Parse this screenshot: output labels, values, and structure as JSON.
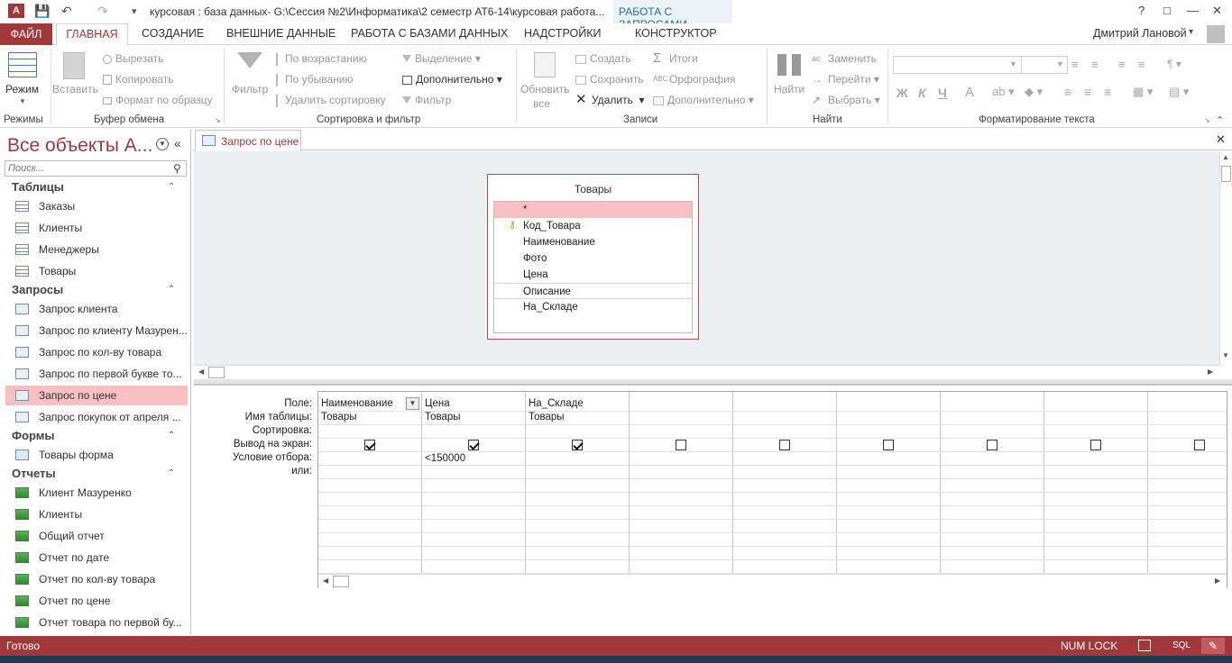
{
  "window": {
    "title": "курсовая : база данных- G:\\Сессия №2\\Информатика\\2 семестр АТ6-14\\курсовая работа...",
    "context_tab": "РАБОТА С ЗАПРОСАМИ",
    "help": "?",
    "user": "Дмитрий Лановой"
  },
  "tabs": {
    "file": "ФАЙЛ",
    "home": "ГЛАВНАЯ",
    "create": "СОЗДАНИЕ",
    "external": "ВНЕШНИЕ ДАННЫЕ",
    "database": "РАБОТА С БАЗАМИ ДАННЫХ",
    "addins": "НАДСТРОЙКИ",
    "designer": "КОНСТРУКТОР"
  },
  "ribbon": {
    "views": {
      "mode": "Режим",
      "group": "Режимы"
    },
    "clipboard": {
      "paste": "Вставить",
      "cut": "Вырезать",
      "copy": "Копировать",
      "format": "Формат по образцу",
      "group": "Буфер обмена"
    },
    "sort": {
      "filter": "Фильтр",
      "asc": "По возрастанию",
      "desc": "По убыванию",
      "remove": "Удалить сортировку",
      "selection": "Выделение",
      "advanced": "Дополнительно",
      "toggle": "Фильтр",
      "group": "Сортировка и фильтр"
    },
    "records": {
      "refresh1": "Обновить",
      "refresh2": "все",
      "new": "Создать",
      "save": "Сохранить",
      "delete": "Удалить",
      "totals": "Итоги",
      "spelling": "Орфография",
      "more": "Дополнительно",
      "group": "Записи"
    },
    "find": {
      "find": "Найти",
      "replace": "Заменить",
      "goto": "Перейти",
      "select": "Выбрать",
      "group": "Найти"
    },
    "text": {
      "group": "Форматирование текста",
      "bold": "Ж",
      "italic": "К",
      "underline": "Ч",
      "fontcolor": "A"
    }
  },
  "nav": {
    "title": "Все объекты A...",
    "search_placeholder": "Поиск...",
    "sections": [
      {
        "label": "Таблицы",
        "items": [
          "Заказы",
          "Клиенты",
          "Менеджеры",
          "Товары"
        ]
      },
      {
        "label": "Запросы",
        "items": [
          "Запрос клиента",
          "Запрос по клиенту Мазурен...",
          "Запрос по кол-ву товара",
          "Запрос по первой букве то...",
          "Запрос по цене",
          "Запрос покупок от апреля ..."
        ]
      },
      {
        "label": "Формы",
        "items": [
          "Товары форма"
        ]
      },
      {
        "label": "Отчеты",
        "items": [
          "Клиент Мазуренко",
          "Клиенты",
          "Общий отчет",
          "Отчет по дате",
          "Отчет по кол-ву товара",
          "Отчет по цене",
          "Отчет товара по первой бу..."
        ]
      }
    ]
  },
  "document": {
    "tab": "Запрос по цене",
    "table": {
      "name": "Товары",
      "fields": [
        "*",
        "Код_Товара",
        "Наименование",
        "Фото",
        "Цена",
        "Описание",
        "На_Складе"
      ]
    },
    "grid": {
      "row_labels": [
        "Поле:",
        "Имя таблицы:",
        "Сортировка:",
        "Вывод на экран:",
        "Условие отбора:",
        "или:"
      ],
      "columns": [
        {
          "field": "Наименование",
          "table": "Товары",
          "show": true,
          "criteria": ""
        },
        {
          "field": "Цена",
          "table": "Товары",
          "show": true,
          "criteria": "<150000"
        },
        {
          "field": "На_Складе",
          "table": "Товары",
          "show": true,
          "criteria": ""
        },
        {
          "field": "",
          "table": "",
          "show": false,
          "criteria": ""
        },
        {
          "field": "",
          "table": "",
          "show": false,
          "criteria": ""
        },
        {
          "field": "",
          "table": "",
          "show": false,
          "criteria": ""
        },
        {
          "field": "",
          "table": "",
          "show": false,
          "criteria": ""
        },
        {
          "field": "",
          "table": "",
          "show": false,
          "criteria": ""
        },
        {
          "field": "",
          "table": "",
          "show": false,
          "criteria": ""
        }
      ]
    }
  },
  "status": {
    "ready": "Готово",
    "numlock": "NUM LOCK",
    "sql": "SQL"
  },
  "colors": {
    "accent": "#a4373a",
    "selection": "#f8c0c3"
  }
}
